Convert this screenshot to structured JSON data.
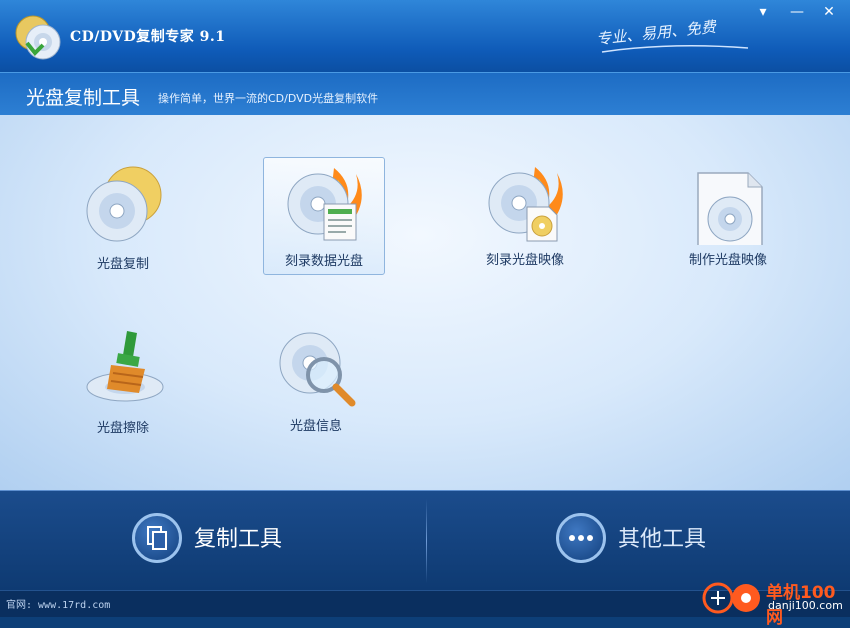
{
  "window": {
    "title": "CD/DVD复制专家 9.1",
    "slogan": "专业、易用、免费",
    "menu_icon": "▾",
    "minimize_icon": "—",
    "close_icon": "✕"
  },
  "header": {
    "title": "光盘复制工具",
    "subtitle": "操作简单，世界一流的CD/DVD光盘复制软件"
  },
  "tools": [
    {
      "label": "光盘复制",
      "icon": "disc-copy-icon"
    },
    {
      "label": "刻录数据光盘",
      "icon": "burn-data-disc-icon",
      "selected": true
    },
    {
      "label": "刻录光盘映像",
      "icon": "burn-disc-image-icon"
    },
    {
      "label": "制作光盘映像",
      "icon": "make-disc-image-icon"
    },
    {
      "label": "光盘擦除",
      "icon": "disc-erase-icon"
    },
    {
      "label": "光盘信息",
      "icon": "disc-info-icon"
    }
  ],
  "bottom_nav": [
    {
      "label": "复制工具",
      "icon": "copy-documents-icon",
      "active": true
    },
    {
      "label": "其他工具",
      "icon": "more-dots-icon",
      "active": false
    }
  ],
  "status": {
    "text": "官网: www.17rd.com"
  },
  "watermark": {
    "name": "单机100网",
    "url": "danji100.com"
  },
  "colors": {
    "title_bar": "#1565c0",
    "main_bg": "#d8e9fb",
    "bottom_bar": "#153f7a",
    "label_text": "#1e3a63",
    "flame": "#ff8a1a"
  }
}
